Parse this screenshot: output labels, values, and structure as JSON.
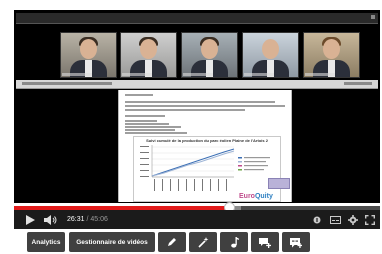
{
  "player": {
    "current_time": "26:31",
    "separator": " / ",
    "duration": "45:06",
    "progress_fraction": 0.588,
    "buffered_fraction": 0.62,
    "colors": {
      "progress": "#e21b1b",
      "controls_bg": "#1b1b1b",
      "action_bg": "#404040"
    }
  },
  "video_content": {
    "chart_title": "Suivi cumulé de la production du parc éolien Plaine de l'Artois 2",
    "logo_left": "Euro",
    "logo_right": "Quity"
  },
  "actions": {
    "analytics_label": "Analytics",
    "video_manager_label": "Gestionnaire de vidéos"
  },
  "icons": {
    "play": "play-icon",
    "volume": "volume-icon",
    "hd": "hd-icon",
    "subtitles": "subtitles-icon",
    "settings": "gear-icon",
    "fullscreen": "fullscreen-icon",
    "enhance": "pencil-icon",
    "effects": "magic-wand-icon",
    "audio": "music-note-icon",
    "annotations": "speech-bubble-plus-icon",
    "captions": "captions-bubble-icon"
  }
}
